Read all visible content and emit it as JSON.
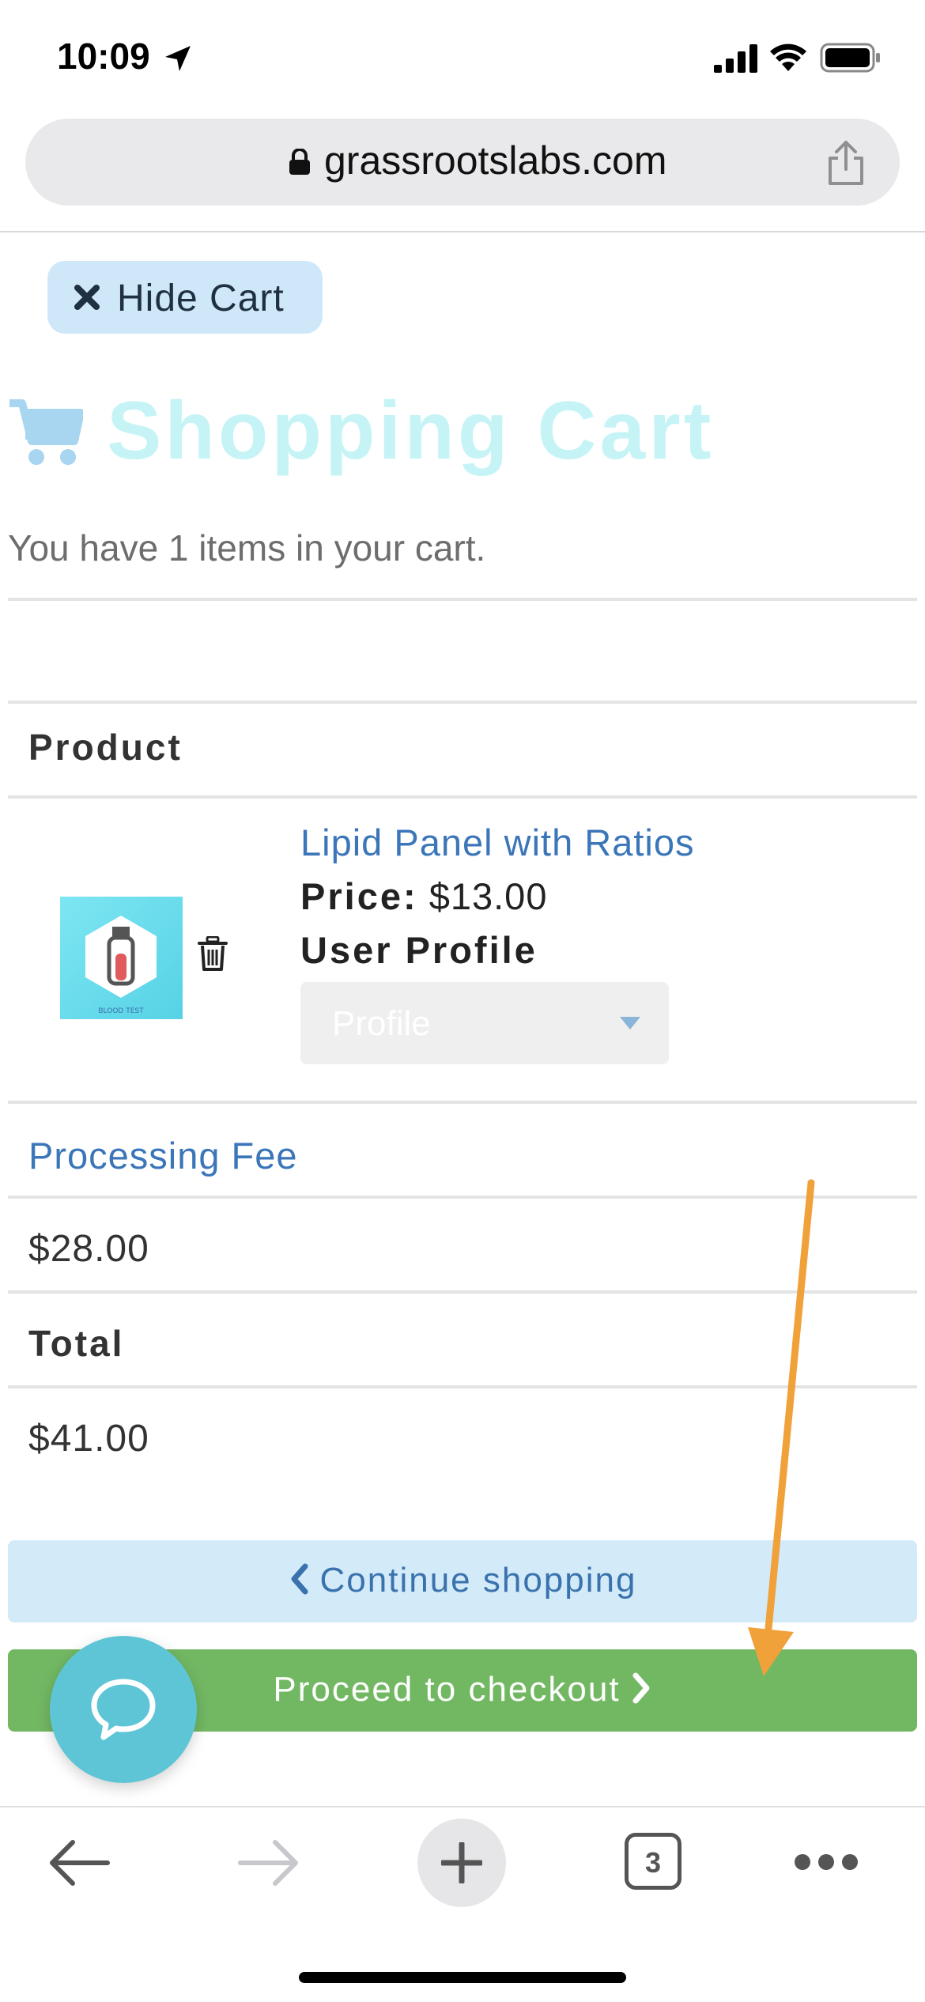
{
  "status_bar": {
    "time": "10:09"
  },
  "browser": {
    "url": "grassrootslabs.com",
    "tab_count": "3"
  },
  "cart": {
    "hide_label": "Hide Cart",
    "title": "Shopping Cart",
    "summary": "You have 1 items in your cart.",
    "product_header": "Product",
    "product": {
      "name": "Lipid Panel with Ratios",
      "price_label": "Price:",
      "price": "$13.00",
      "profile_label": "User Profile",
      "profile_placeholder": "Profile",
      "thumb_caption": "BLOOD TEST"
    },
    "fee_label": "Processing Fee",
    "fee_value": "$28.00",
    "total_label": "Total",
    "total_value": "$41.00",
    "continue_label": "Continue shopping",
    "checkout_label": "Proceed to checkout"
  },
  "colors": {
    "accent_link": "#3b76b9",
    "checkout_green": "#72b863",
    "continue_blue": "#d3eaf9",
    "chat_teal": "#5ec5d6",
    "annotation_orange": "#f0a13a"
  }
}
